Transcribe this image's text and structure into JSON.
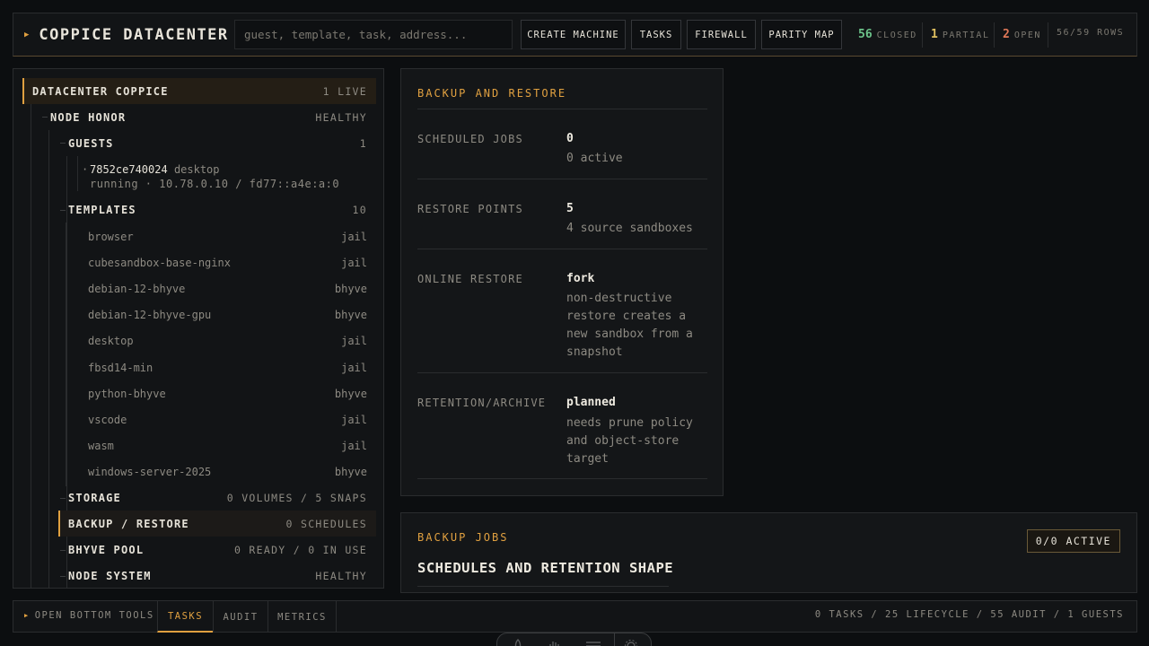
{
  "header": {
    "title": "COPPICE DATACENTER",
    "search_placeholder": "guest, template, task, address...",
    "buttons": [
      "CREATE MACHINE",
      "TASKS",
      "FIREWALL",
      "PARITY MAP"
    ],
    "stats": {
      "closed_count": "56",
      "closed_label": "CLOSED",
      "partial_count": "1",
      "partial_label": "PARTIAL",
      "open_count": "2",
      "open_label": "OPEN",
      "rows": "56/59 ROWS"
    },
    "colors": {
      "accent": "#e0a040",
      "closed": "#6cc38a",
      "partial": "#e0c060",
      "open": "#e07858"
    }
  },
  "tree": {
    "root": {
      "label": "DATACENTER COPPICE",
      "meta": "1 LIVE"
    },
    "node": {
      "label": "NODE HONOR",
      "meta": "HEALTHY"
    },
    "guests": {
      "label": "GUESTS",
      "meta": "1"
    },
    "guest": {
      "id": "7852ce740024",
      "tag": "desktop",
      "status": "running · 10.78.0.10 / fd77::a4e:a:0"
    },
    "templates": {
      "label": "TEMPLATES",
      "meta": "10"
    },
    "template_items": [
      {
        "name": "browser",
        "type": "jail"
      },
      {
        "name": "cubesandbox-base-nginx",
        "type": "jail"
      },
      {
        "name": "debian-12-bhyve",
        "type": "bhyve"
      },
      {
        "name": "debian-12-bhyve-gpu",
        "type": "bhyve"
      },
      {
        "name": "desktop",
        "type": "jail"
      },
      {
        "name": "fbsd14-min",
        "type": "jail"
      },
      {
        "name": "python-bhyve",
        "type": "bhyve"
      },
      {
        "name": "vscode",
        "type": "jail"
      },
      {
        "name": "wasm",
        "type": "jail"
      },
      {
        "name": "windows-server-2025",
        "type": "bhyve"
      }
    ],
    "storage": {
      "label": "STORAGE",
      "meta": "0 VOLUMES / 5 SNAPS"
    },
    "backup": {
      "label": "BACKUP / RESTORE",
      "meta": "0 SCHEDULES"
    },
    "pool": {
      "label": "BHYVE POOL",
      "meta": "0 READY / 0 IN USE"
    },
    "system": {
      "label": "NODE SYSTEM",
      "meta": "HEALTHY"
    }
  },
  "backup_card": {
    "title": "BACKUP AND RESTORE",
    "rows": [
      {
        "key": "SCHEDULED JOBS",
        "value": "0",
        "sub": "0 active"
      },
      {
        "key": "RESTORE POINTS",
        "value": "5",
        "sub": "4 source sandboxes"
      },
      {
        "key": "ONLINE RESTORE",
        "value": "fork",
        "sub": "non-destructive restore creates a new sandbox from a snapshot"
      },
      {
        "key": "RETENTION/ARCHIVE",
        "value": "planned",
        "sub": "needs prune policy and object-store target"
      }
    ]
  },
  "jobs": {
    "title": "BACKUP JOBS",
    "heading": "SCHEDULES AND RETENTION SHAPE",
    "badge": "0/0 ACTIVE"
  },
  "bottom": {
    "open_tools": "OPEN BOTTOM TOOLS",
    "tabs": [
      "TASKS",
      "AUDIT",
      "METRICS"
    ],
    "active_tab": "TASKS",
    "summary": "0 TASKS / 25 LIFECYCLE / 55 AUDIT / 1 GUESTS"
  },
  "dock": {
    "icons": [
      "rocket-icon",
      "hand-icon",
      "menu-icon",
      "gear-icon"
    ]
  }
}
